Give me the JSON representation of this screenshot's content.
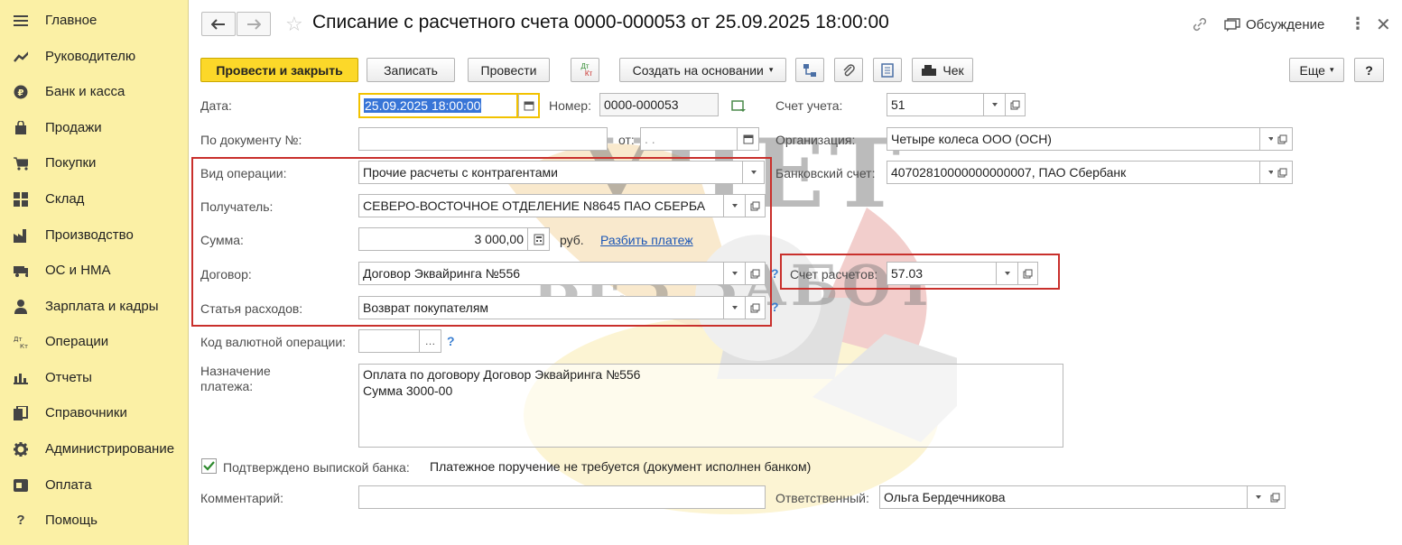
{
  "sidebar": {
    "items": [
      {
        "label": "Главное",
        "icon": "menu-icon"
      },
      {
        "label": "Руководителю",
        "icon": "trend-icon"
      },
      {
        "label": "Банк и касса",
        "icon": "ruble-coin-icon"
      },
      {
        "label": "Продажи",
        "icon": "shopping-bag-icon"
      },
      {
        "label": "Покупки",
        "icon": "shopping-cart-icon"
      },
      {
        "label": "Склад",
        "icon": "warehouse-grid-icon"
      },
      {
        "label": "Производство",
        "icon": "factory-icon"
      },
      {
        "label": "ОС и НМА",
        "icon": "truck-icon"
      },
      {
        "label": "Зарплата и кадры",
        "icon": "person-icon"
      },
      {
        "label": "Операции",
        "icon": "dt-kt-icon"
      },
      {
        "label": "Отчеты",
        "icon": "bar-chart-icon"
      },
      {
        "label": "Справочники",
        "icon": "books-icon"
      },
      {
        "label": "Администрирование",
        "icon": "gear-icon"
      },
      {
        "label": "Оплата",
        "icon": "payment-icon"
      },
      {
        "label": "Помощь",
        "icon": "question-icon"
      }
    ]
  },
  "header": {
    "title": "Списание с расчетного счета 0000-000053 от 25.09.2025 18:00:00",
    "discussion_label": "Обсуждение"
  },
  "toolbar": {
    "post_close": "Провести и закрыть",
    "save": "Записать",
    "post": "Провести",
    "dtkt_top": "Дт",
    "dtkt_bottom": "Кт",
    "create_based": "Создать на основании",
    "check": "Чек",
    "more": "Еще",
    "help": "?"
  },
  "form": {
    "date_label": "Дата:",
    "date_value": "25.09.2025 18:00:00",
    "number_label": "Номер:",
    "number_value": "0000-000053",
    "account_label": "Счет учета:",
    "account_value": "51",
    "doc_label": "По документу №:",
    "doc_value": "",
    "from_label": "от:",
    "from_value": ". .",
    "org_label": "Организация:",
    "org_value": "Четыре колеса ООО (ОСН)",
    "op_label": "Вид операции:",
    "op_value": "Прочие расчеты с контрагентами",
    "bank_label": "Банковский счет:",
    "bank_value": "40702810000000000007, ПАО Сбербанк",
    "recipient_label": "Получатель:",
    "recipient_value": "СЕВЕРО-ВОСТОЧНОЕ ОТДЕЛЕНИЕ N8645 ПАО СБЕРБА",
    "sum_label": "Сумма:",
    "sum_value": "3 000,00",
    "sum_currency": "руб.",
    "split_link": "Разбить платеж",
    "contract_label": "Договор:",
    "contract_value": "Договор Эквайринга №556",
    "settle_label": "Счет расчетов:",
    "settle_value": "57.03",
    "expense_label": "Статья расходов:",
    "expense_value": "Возврат покупателям",
    "currency_op_label": "Код валютной операции:",
    "currency_op_value": "",
    "purpose_label_1": "Назначение",
    "purpose_label_2": "платежа:",
    "purpose_line_1": "Оплата по договору Договор Эквайринга №556",
    "purpose_line_2": "Сумма 3000-00",
    "confirmed_label": "Подтверждено выпиской банка:",
    "confirmed_note": "Платежное поручение не требуется (документ исполнен банком)",
    "comment_label": "Комментарий:",
    "comment_value": "",
    "responsible_label": "Ответственный:",
    "responsible_value": "Ольга Бердечникова"
  },
  "watermark": {
    "line1": "УЧЕТ",
    "line2": "БЕЗ ЗАБОТ"
  },
  "colors": {
    "sidebar_bg": "#fbf0a5",
    "primary_button": "#fcd829",
    "highlight_border": "#c9302c",
    "link": "#1c56b5"
  }
}
